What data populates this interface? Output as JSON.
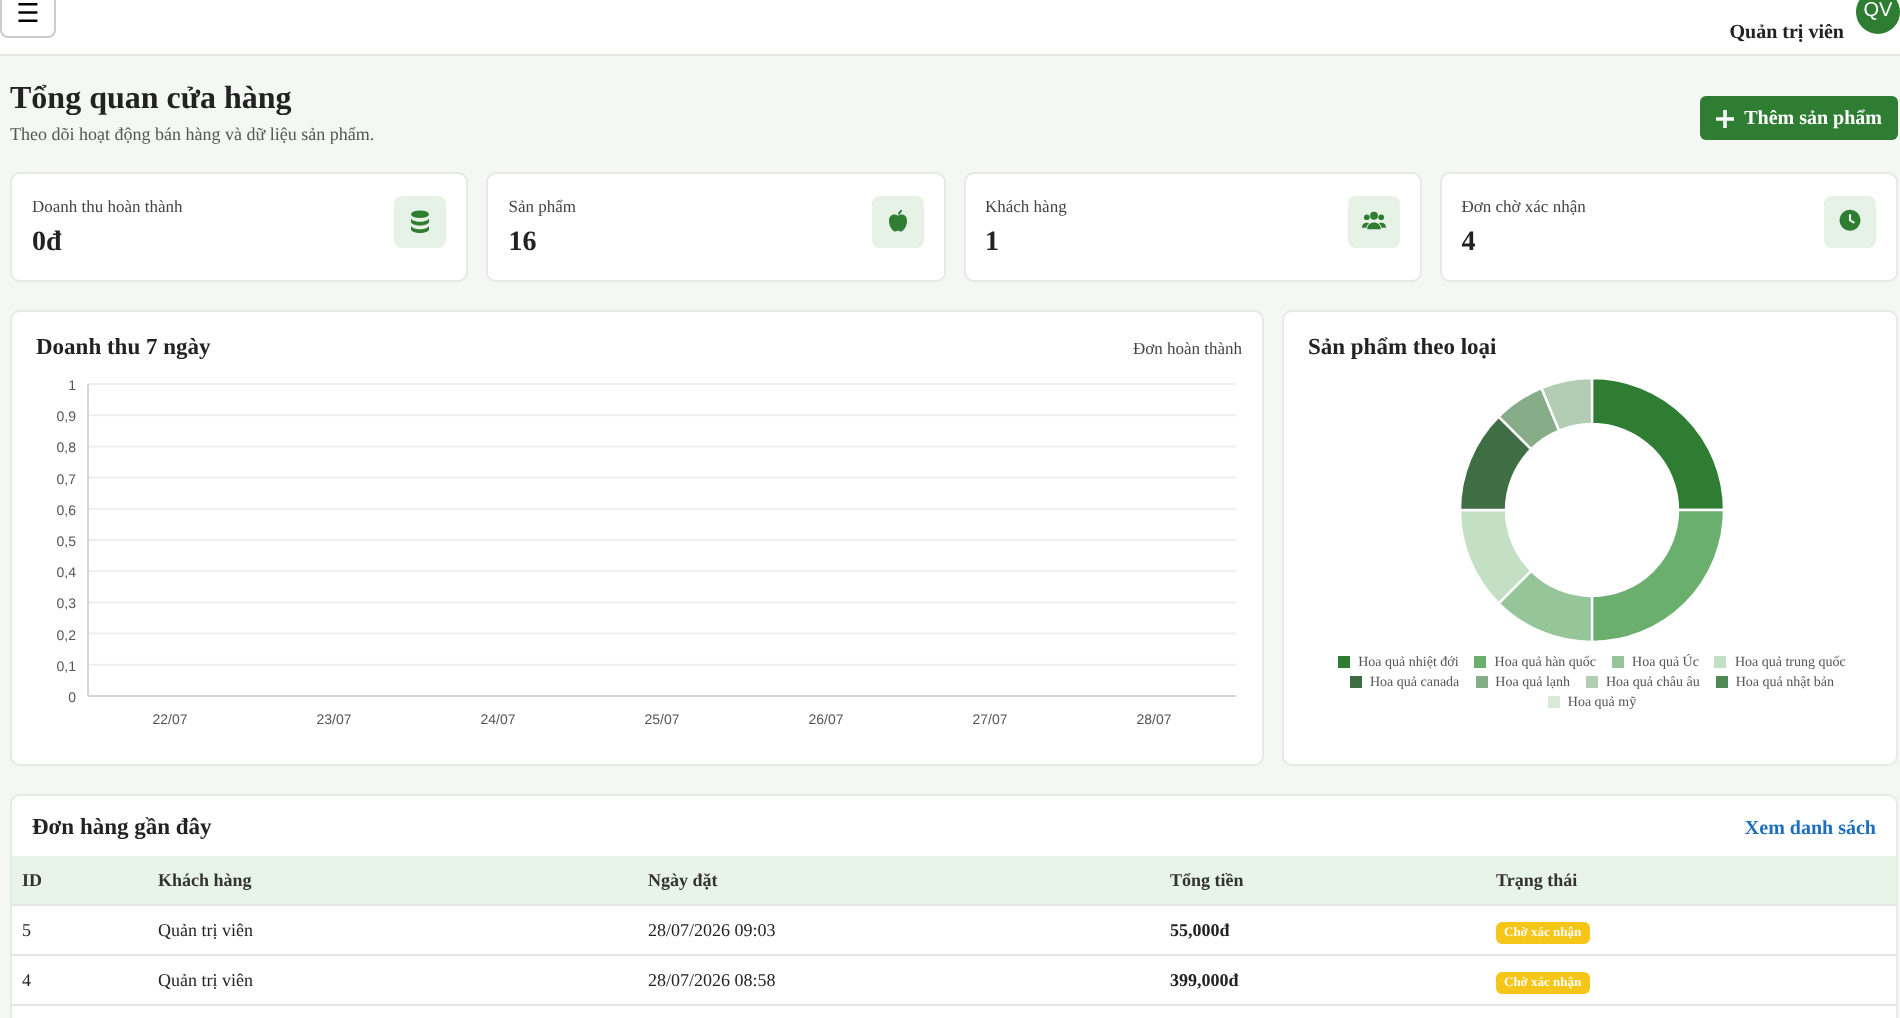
{
  "topbar": {
    "menu_icon": "☰",
    "user_name": "Quản trị viên",
    "avatar_initials": "QV"
  },
  "header": {
    "title": "Tổng quan cửa hàng",
    "subtitle": "Theo dõi hoạt động bán hàng và dữ liệu sản phẩm.",
    "add_button": "Thêm sản phẩm"
  },
  "stats": [
    {
      "label": "Doanh thu hoàn thành",
      "value": "0đ",
      "kind": "coins"
    },
    {
      "label": "Sản phẩm",
      "value": "16",
      "kind": "apple"
    },
    {
      "label": "Khách hàng",
      "value": "1",
      "kind": "users"
    },
    {
      "label": "Đơn chờ xác nhận",
      "value": "4",
      "kind": "clock"
    }
  ],
  "revenue_chart": {
    "title": "Doanh thu 7 ngày",
    "note": "Đơn hoàn thành",
    "chart_data": {
      "type": "line",
      "grid": true,
      "categories": [
        "22/07",
        "23/07",
        "24/07",
        "25/07",
        "26/07",
        "27/07",
        "28/07"
      ],
      "ylim": [
        0,
        1
      ],
      "yticks": [
        {
          "value": 0,
          "label": "0"
        },
        {
          "value": 0.1,
          "label": "0,1"
        },
        {
          "value": 0.2,
          "label": "0,2"
        },
        {
          "value": 0.3,
          "label": "0,3"
        },
        {
          "value": 0.4,
          "label": "0,4"
        },
        {
          "value": 0.5,
          "label": "0,5"
        },
        {
          "value": 0.6,
          "label": "0,6"
        },
        {
          "value": 0.7,
          "label": "0,7"
        },
        {
          "value": 0.8,
          "label": "0,8"
        },
        {
          "value": 0.9,
          "label": "0,9"
        },
        {
          "value": 1,
          "label": "1"
        }
      ]
    }
  },
  "category_chart": {
    "title": "Sản phẩm theo loại",
    "chart_data": {
      "type": "donut",
      "categories": [
        "Hoa quả nhiệt đới",
        "Hoa quả hàn quốc",
        "Hoa quả Úc",
        "Hoa quả trung quốc",
        "Hoa quả canada",
        "Hoa quả lạnh",
        "Hoa quả châu âu",
        "Hoa quả nhật bản",
        "Hoa quả mỹ"
      ],
      "series": [
        {
          "colors": [
            "#2e7d32",
            "#6aaf6e",
            "#97c59a",
            "#c3dfc4",
            "#3f6e45",
            "#86ad88",
            "#b2cdb3",
            "#4f8a56",
            "#d8ebd9"
          ],
          "values": [
            25,
            25,
            12.5,
            12.5,
            12.5,
            6.25,
            6.25,
            0,
            0
          ]
        }
      ]
    }
  },
  "orders": {
    "title": "Đơn hàng gần đây",
    "link": "Xem danh sách",
    "columns": [
      "ID",
      "Khách hàng",
      "Ngày đặt",
      "Tổng tiền",
      "Trạng thái"
    ],
    "rows": [
      {
        "id": "5",
        "customer": "Quản trị viên",
        "date": "28/07/2026 09:03",
        "total": "55,000đ",
        "status": "Chờ xác nhận"
      },
      {
        "id": "4",
        "customer": "Quản trị viên",
        "date": "28/07/2026 08:58",
        "total": "399,000đ",
        "status": "Chờ xác nhận"
      }
    ]
  }
}
